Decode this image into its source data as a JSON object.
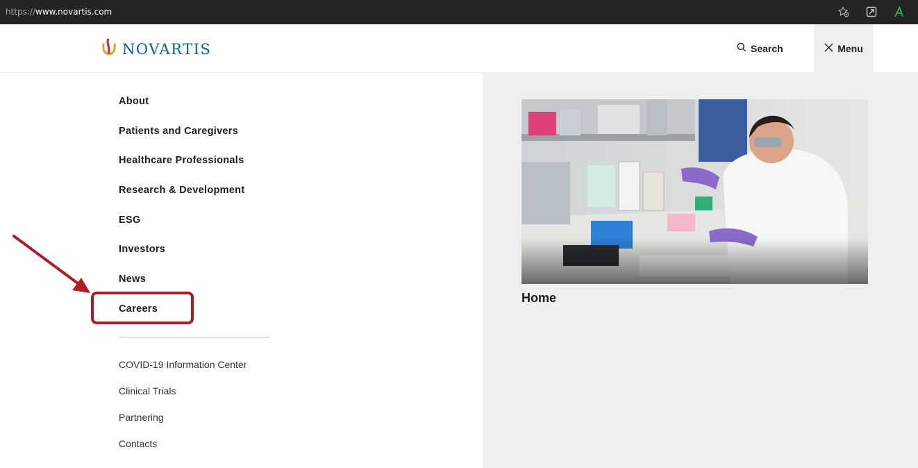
{
  "browser": {
    "url_protocol": "https://",
    "url_host": "www.novartis.com"
  },
  "header": {
    "logo_text": "NOVARTIS",
    "search_label": "Search",
    "menu_label": "Menu"
  },
  "nav": {
    "primary": [
      "About",
      "Patients and Caregivers",
      "Healthcare Professionals",
      "Research & Development",
      "ESG",
      "Investors",
      "News",
      "Careers"
    ],
    "secondary": [
      "COVID-19 Information Center",
      "Clinical Trials",
      "Partnering",
      "Contacts"
    ]
  },
  "feature": {
    "caption": "Home"
  },
  "colors": {
    "brand_blue": "#0460a9",
    "logo_orange": "#ec9a1e",
    "annotation_red": "#b01c22",
    "panel_gray": "#efefef"
  }
}
